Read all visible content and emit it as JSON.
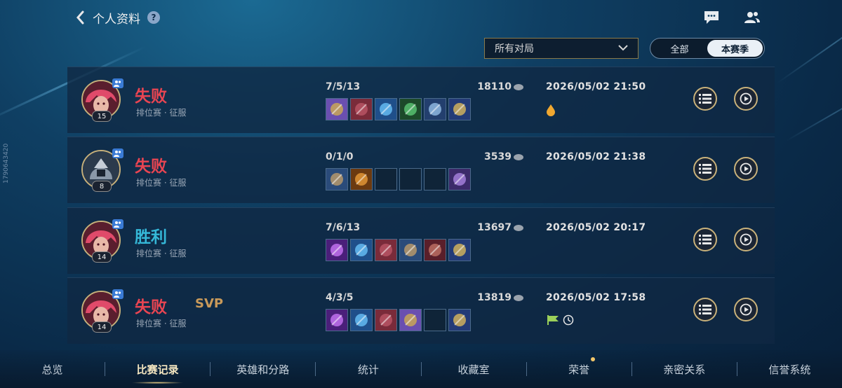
{
  "header": {
    "title": "个人资料",
    "help_icon": "?"
  },
  "filter": {
    "selected": "所有对局"
  },
  "season_toggle": {
    "options": [
      "全部",
      "本赛季"
    ],
    "active_index": 1
  },
  "side_text": "1790643420",
  "matches": [
    {
      "result": "失败",
      "result_type": "lose",
      "mode": "排位赛 · 征服",
      "level": "15",
      "kda": "7/5/13",
      "gold": "18110",
      "date": "2026/05/02 21:50",
      "svp": "",
      "avatar": "pink-hair-hero",
      "items": [
        "gem-helmet",
        "red-mask",
        "blue-staff",
        "green-blade",
        "trident",
        "hourglass"
      ],
      "badges": [
        "drop-icon"
      ]
    },
    {
      "result": "失败",
      "result_type": "lose",
      "mode": "排位赛 · 征服",
      "level": "8",
      "kda": "0/1/0",
      "gold": "3539",
      "date": "2026/05/02 21:38",
      "svp": "",
      "avatar": "armored-knight-hero",
      "items": [
        "blue-book",
        "golden-mace",
        "",
        "",
        "",
        "purple-boots"
      ],
      "badges": []
    },
    {
      "result": "胜利",
      "result_type": "win",
      "mode": "排位赛 · 征服",
      "level": "14",
      "kda": "7/6/13",
      "gold": "13697",
      "date": "2026/05/02 20:17",
      "svp": "",
      "avatar": "pink-hair-hero",
      "items": [
        "purple-crystal",
        "blue-staff",
        "red-mask",
        "blue-book",
        "red-book",
        "hourglass"
      ],
      "badges": []
    },
    {
      "result": "失败",
      "result_type": "lose",
      "mode": "排位赛 · 征服",
      "level": "14",
      "kda": "4/3/5",
      "gold": "13819",
      "date": "2026/05/02 17:58",
      "svp": "SVP",
      "avatar": "pink-hair-hero",
      "items": [
        "purple-crystal",
        "blue-staff",
        "red-mask",
        "gem-helmet",
        "",
        "hourglass"
      ],
      "badges": [
        "green-flag-icon",
        "clock-icon"
      ]
    }
  ],
  "nav": {
    "tabs": [
      "总览",
      "比赛记录",
      "英雄和分路",
      "统计",
      "收藏室",
      "荣誉",
      "亲密关系",
      "信誉系统"
    ],
    "active_index": 1
  },
  "colors": {
    "lose": "#e84552",
    "win": "#35b8d8",
    "accent_gold": "#c9b27b"
  }
}
